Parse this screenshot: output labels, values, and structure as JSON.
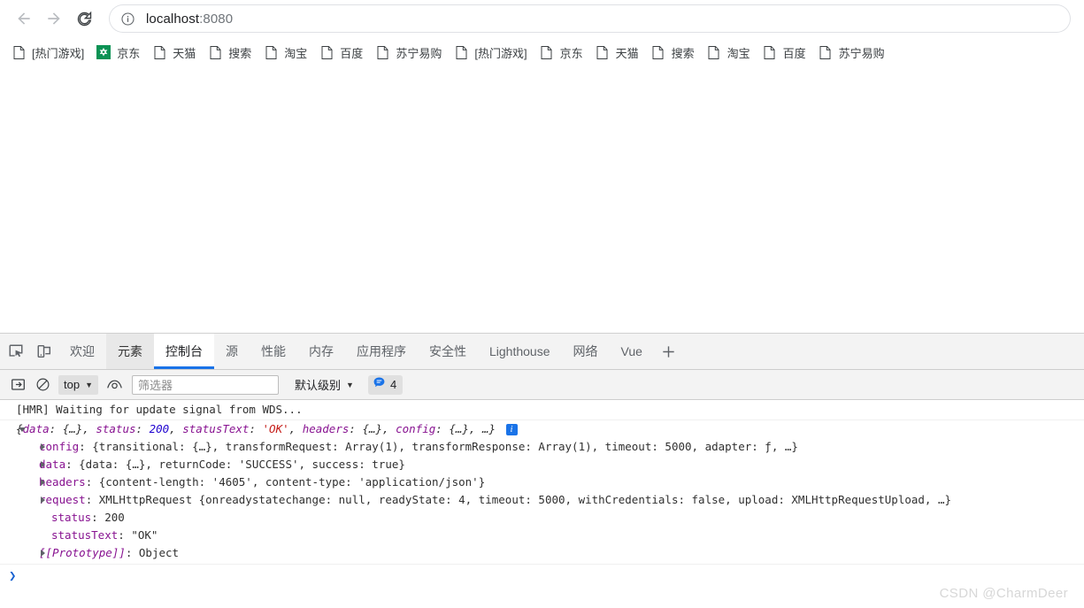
{
  "browser": {
    "back_label": "Back",
    "forward_label": "Forward",
    "reload_label": "Reload",
    "site_info_label": "Site information",
    "url_host": "localhost",
    "url_port": ":8080"
  },
  "bookmarks": [
    {
      "label": "[热门游戏]",
      "icon": "page-icon"
    },
    {
      "label": "京东",
      "icon": "jd-icon"
    },
    {
      "label": "天猫",
      "icon": "page-icon"
    },
    {
      "label": "搜索",
      "icon": "page-icon"
    },
    {
      "label": "淘宝",
      "icon": "page-icon"
    },
    {
      "label": "百度",
      "icon": "page-icon"
    },
    {
      "label": "苏宁易购",
      "icon": "page-icon"
    },
    {
      "label": "[热门游戏]",
      "icon": "page-icon"
    },
    {
      "label": "京东",
      "icon": "page-icon"
    },
    {
      "label": "天猫",
      "icon": "page-icon"
    },
    {
      "label": "搜索",
      "icon": "page-icon"
    },
    {
      "label": "淘宝",
      "icon": "page-icon"
    },
    {
      "label": "百度",
      "icon": "page-icon"
    },
    {
      "label": "苏宁易购",
      "icon": "page-icon"
    }
  ],
  "devtools": {
    "inspect_label": "Inspect element",
    "device_label": "Toggle device toolbar",
    "tabs": [
      {
        "label": "欢迎",
        "state": "normal"
      },
      {
        "label": "元素",
        "state": "hovered"
      },
      {
        "label": "控制台",
        "state": "active"
      },
      {
        "label": "源",
        "state": "normal"
      },
      {
        "label": "性能",
        "state": "normal"
      },
      {
        "label": "内存",
        "state": "normal"
      },
      {
        "label": "应用程序",
        "state": "normal"
      },
      {
        "label": "安全性",
        "state": "normal"
      },
      {
        "label": "Lighthouse",
        "state": "normal"
      },
      {
        "label": "网络",
        "state": "normal"
      },
      {
        "label": "Vue",
        "state": "normal"
      }
    ],
    "more_tabs_label": "+",
    "toolbar": {
      "sidebar_toggle_label": "Show console sidebar",
      "clear_label": "Clear console",
      "context": "top",
      "eye_label": "Create live expression",
      "filter_placeholder": "筛选器",
      "filter_value": "",
      "level": "默认级别",
      "issues_count": "4",
      "issues_icon": "speech-bubble-icon"
    },
    "console": {
      "hmr_message": "[HMR] Waiting for update signal from WDS...",
      "object": {
        "summary": {
          "open": "{",
          "parts": [
            {
              "key": "data",
              "sep": ": ",
              "val": "{…}",
              "type": "plain",
              "tail": ", "
            },
            {
              "key": "status",
              "sep": ": ",
              "val": "200",
              "type": "num",
              "tail": ", "
            },
            {
              "key": "statusText",
              "sep": ": ",
              "val": "'OK'",
              "type": "str",
              "tail": ", "
            },
            {
              "key": "headers",
              "sep": ": ",
              "val": "{…}",
              "type": "plain",
              "tail": ", "
            },
            {
              "key": "config",
              "sep": ": ",
              "val": "{…}",
              "type": "plain",
              "tail": ", "
            }
          ],
          "ellipsis": "…",
          "close": "}",
          "badge": "i"
        },
        "rows": [
          {
            "arrow": true,
            "key": "config",
            "value_text": ": {transitional: {…}, transformRequest: Array(1), transformResponse: Array(1), timeout: 5000, adapter: ƒ, …}"
          },
          {
            "arrow": true,
            "key": "data",
            "value_text": ": {data: {…}, returnCode: 'SUCCESS', success: true}"
          },
          {
            "arrow": true,
            "key": "headers",
            "value_text": ": {content-length: '4605', content-type: 'application/json'}"
          },
          {
            "arrow": true,
            "key": "request",
            "value_text": ": XMLHttpRequest {onreadystatechange: null, readyState: 4, timeout: 5000, withCredentials: false, upload: XMLHttpRequestUpload, …}"
          },
          {
            "arrow": false,
            "key": "status",
            "value_text": ": 200"
          },
          {
            "arrow": false,
            "key": "statusText",
            "value_text": ": \"OK\""
          },
          {
            "arrow": true,
            "key": "[[Prototype]]",
            "value_text": ": Object"
          }
        ]
      },
      "prompt_symbol": "❯"
    }
  },
  "watermark": "CSDN @CharmDeer"
}
